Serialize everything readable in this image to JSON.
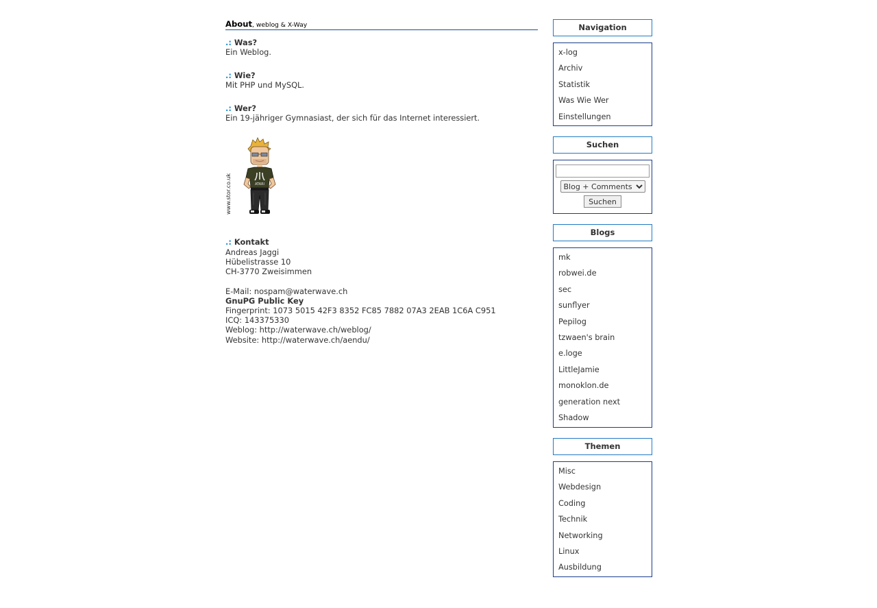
{
  "main": {
    "title": "About",
    "subtitle": ", weblog & X-Way",
    "dots": ".:",
    "sections": [
      {
        "heading": "Was?",
        "text": "Ein Weblog."
      },
      {
        "heading": "Wie?",
        "text": "Mit PHP und MySQL."
      },
      {
        "heading": "Wer?",
        "text": "Ein 19-jähriger Gymnasiast, der sich für das Internet interessiert."
      }
    ],
    "avatar_credit": "www.stor.co.uk",
    "avatar_shirt": "ATARI",
    "contact": {
      "heading": "Kontakt",
      "name": "Andreas Jaggi",
      "street": "Hübelistrasse 10",
      "city": "CH-3770 Zweisimmen",
      "email_label": "E-Mail: ",
      "email": "nospam@waterwave.ch",
      "gnupg": "GnuPG Public Key",
      "fingerprint": "Fingerprint: 1073 5015 42F3 8352 FC85 7882 07A3 2EAB 1C6A C951",
      "icq": "ICQ: 143375330",
      "weblog_label": "Weblog: ",
      "weblog": "http://waterwave.ch/weblog/",
      "website_label": "Website: ",
      "website": "http://waterwave.ch/aendu/"
    }
  },
  "sidebar": {
    "navigation": {
      "title": "Navigation",
      "items": [
        "x-log",
        "Archiv",
        "Statistik",
        "Was Wie Wer",
        "Einstellungen"
      ]
    },
    "search": {
      "title": "Suchen",
      "input_value": "",
      "select_value": "Blog + Comments",
      "button_label": "Suchen"
    },
    "blogs": {
      "title": "Blogs",
      "items": [
        "mk",
        "robwei.de",
        "sec",
        "sunflyer",
        "Pepilog",
        "tzwaen's brain",
        "e.loge",
        "LittleJamie",
        "monoklon.de",
        "generation next",
        "Shadow"
      ]
    },
    "themen": {
      "title": "Themen",
      "items": [
        "Misc",
        "Webdesign",
        "Coding",
        "Technik",
        "Networking",
        "Linux",
        "Ausbildung"
      ]
    }
  },
  "colors": {
    "accent_dots": "#1f8fd6",
    "title_border": "#1f7bc4",
    "box_border": "#1a3c8a",
    "text": "#333333"
  }
}
